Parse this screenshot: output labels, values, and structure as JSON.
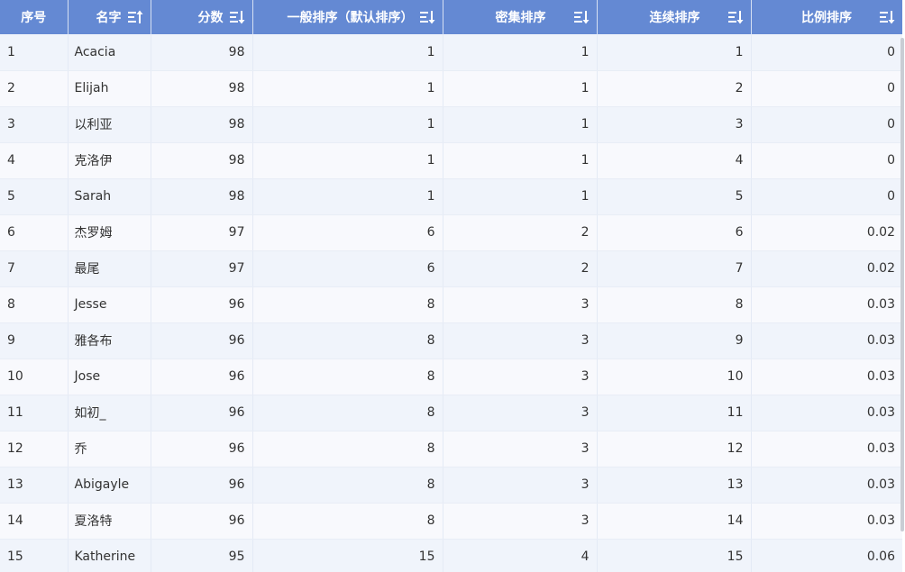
{
  "columns": {
    "index": "序号",
    "name": "名字",
    "score": "分数",
    "normal_rank": "一般排序（默认排序）",
    "dense_rank": "密集排序",
    "continuous_rank": "连续排序",
    "ratio_rank": "比例排序"
  },
  "icons": {
    "sort": "sort-icon"
  },
  "colors": {
    "header_bg": "#6489d3",
    "row_odd": "#f0f4fb",
    "row_even": "#f8f9fd"
  },
  "rows": [
    {
      "index": "1",
      "name": "Acacia",
      "score": "98",
      "normal": "1",
      "dense": "1",
      "continuous": "1",
      "ratio": "0"
    },
    {
      "index": "2",
      "name": "Elijah",
      "score": "98",
      "normal": "1",
      "dense": "1",
      "continuous": "2",
      "ratio": "0"
    },
    {
      "index": "3",
      "name": "以利亚",
      "score": "98",
      "normal": "1",
      "dense": "1",
      "continuous": "3",
      "ratio": "0"
    },
    {
      "index": "4",
      "name": "克洛伊",
      "score": "98",
      "normal": "1",
      "dense": "1",
      "continuous": "4",
      "ratio": "0"
    },
    {
      "index": "5",
      "name": "Sarah",
      "score": "98",
      "normal": "1",
      "dense": "1",
      "continuous": "5",
      "ratio": "0"
    },
    {
      "index": "6",
      "name": "杰罗姆",
      "score": "97",
      "normal": "6",
      "dense": "2",
      "continuous": "6",
      "ratio": "0.02"
    },
    {
      "index": "7",
      "name": "最尾",
      "score": "97",
      "normal": "6",
      "dense": "2",
      "continuous": "7",
      "ratio": "0.02"
    },
    {
      "index": "8",
      "name": "Jesse",
      "score": "96",
      "normal": "8",
      "dense": "3",
      "continuous": "8",
      "ratio": "0.03"
    },
    {
      "index": "9",
      "name": "雅各布",
      "score": "96",
      "normal": "8",
      "dense": "3",
      "continuous": "9",
      "ratio": "0.03"
    },
    {
      "index": "10",
      "name": "Jose",
      "score": "96",
      "normal": "8",
      "dense": "3",
      "continuous": "10",
      "ratio": "0.03"
    },
    {
      "index": "11",
      "name": "如初_",
      "score": "96",
      "normal": "8",
      "dense": "3",
      "continuous": "11",
      "ratio": "0.03"
    },
    {
      "index": "12",
      "name": "乔",
      "score": "96",
      "normal": "8",
      "dense": "3",
      "continuous": "12",
      "ratio": "0.03"
    },
    {
      "index": "13",
      "name": "Abigayle",
      "score": "96",
      "normal": "8",
      "dense": "3",
      "continuous": "13",
      "ratio": "0.03"
    },
    {
      "index": "14",
      "name": "夏洛特",
      "score": "96",
      "normal": "8",
      "dense": "3",
      "continuous": "14",
      "ratio": "0.03"
    },
    {
      "index": "15",
      "name": "Katherine",
      "score": "95",
      "normal": "15",
      "dense": "4",
      "continuous": "15",
      "ratio": "0.06"
    }
  ]
}
